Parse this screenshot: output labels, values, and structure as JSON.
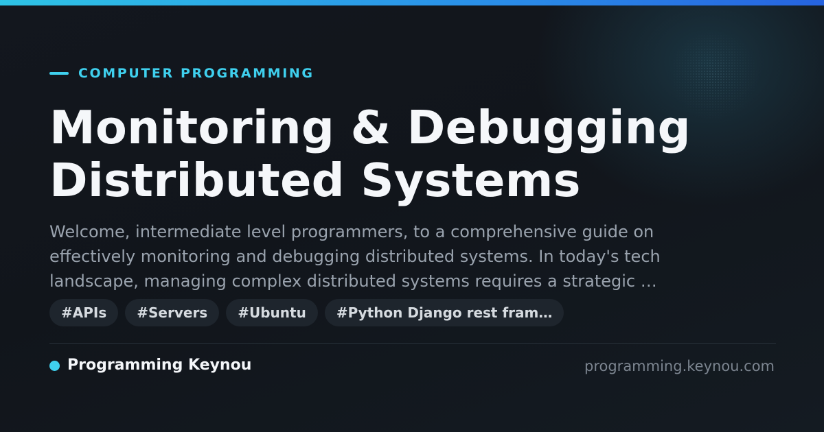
{
  "colors": {
    "accent": "#3fd0ee",
    "background": "#12161d",
    "title": "#f5f7fa",
    "body_text": "#9aa3ae",
    "tag_bg": "#1e252d"
  },
  "header": {
    "category": "COMPUTER PROGRAMMING"
  },
  "article": {
    "title_line1": "Monitoring & Debugging",
    "title_line2": "Distributed Systems",
    "description_line1": "Welcome, intermediate level programmers, to a comprehensive guide on",
    "description_line2": "effectively monitoring and debugging distributed systems. In today's tech",
    "description_line3": "landscape, managing complex distributed systems requires a strategic …"
  },
  "tags": [
    "#APIs",
    "#Servers",
    "#Ubuntu",
    "#Python Django rest fram…"
  ],
  "footer": {
    "brand_name": "Programming Keynou",
    "site_url": "programming.keynou.com"
  }
}
